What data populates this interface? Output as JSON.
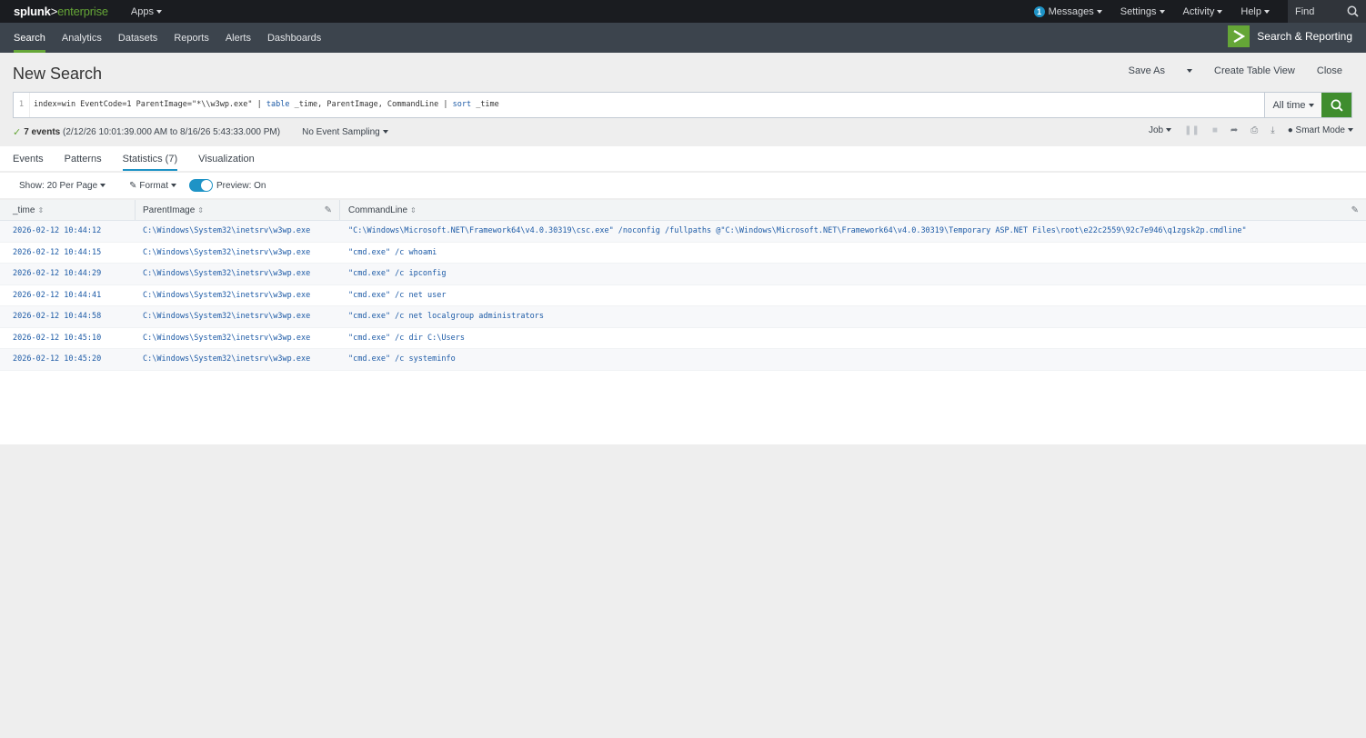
{
  "topbar": {
    "logo_brand": "splunk",
    "logo_gt": ">",
    "logo_product": "enterprise",
    "apps_label": "Apps",
    "messages_count": "1",
    "messages_label": "Messages",
    "settings_label": "Settings",
    "activity_label": "Activity",
    "help_label": "Help",
    "find_placeholder": "Find"
  },
  "appnav": {
    "items": [
      {
        "label": "Search",
        "active": true
      },
      {
        "label": "Analytics"
      },
      {
        "label": "Datasets"
      },
      {
        "label": "Reports"
      },
      {
        "label": "Alerts"
      },
      {
        "label": "Dashboards"
      }
    ],
    "app_title": "Search & Reporting",
    "app_color": "#65a637"
  },
  "header": {
    "title": "New Search",
    "save_as": "Save As",
    "create_table_view": "Create Table View",
    "close": "Close"
  },
  "search": {
    "line_number": "1",
    "query_part1": "index=win EventCode=1 ParentImage=\"*\\\\w3wp.exe\" | ",
    "query_kw1": "table",
    "query_part2": " _time, ParentImage, CommandLine | ",
    "query_kw2": "sort",
    "query_part3": " _time",
    "time_range": "All time"
  },
  "status": {
    "events_label": "7 events",
    "time_span": "(2/12/26 10:01:39.000 AM to 8/16/26 5:43:33.000 PM)",
    "sampling": "No Event Sampling",
    "job": "Job",
    "mode": "Smart Mode"
  },
  "tabs": [
    {
      "label": "Events"
    },
    {
      "label": "Patterns"
    },
    {
      "label": "Statistics (7)",
      "active": true
    },
    {
      "label": "Visualization"
    }
  ],
  "toolbar": {
    "per_page": "Show: 20 Per Page",
    "format": "Format",
    "preview": "Preview: On"
  },
  "table": {
    "columns": [
      "_time",
      "ParentImage",
      "CommandLine"
    ],
    "rows": [
      [
        "2026-02-12 10:44:12",
        "C:\\Windows\\System32\\inetsrv\\w3wp.exe",
        "\"C:\\Windows\\Microsoft.NET\\Framework64\\v4.0.30319\\csc.exe\" /noconfig /fullpaths @\"C:\\Windows\\Microsoft.NET\\Framework64\\v4.0.30319\\Temporary ASP.NET Files\\root\\e22c2559\\92c7e946\\q1zgsk2p.cmdline\""
      ],
      [
        "2026-02-12 10:44:15",
        "C:\\Windows\\System32\\inetsrv\\w3wp.exe",
        "\"cmd.exe\" /c whoami"
      ],
      [
        "2026-02-12 10:44:29",
        "C:\\Windows\\System32\\inetsrv\\w3wp.exe",
        "\"cmd.exe\" /c ipconfig"
      ],
      [
        "2026-02-12 10:44:41",
        "C:\\Windows\\System32\\inetsrv\\w3wp.exe",
        "\"cmd.exe\" /c net user"
      ],
      [
        "2026-02-12 10:44:58",
        "C:\\Windows\\System32\\inetsrv\\w3wp.exe",
        "\"cmd.exe\" /c net localgroup administrators"
      ],
      [
        "2026-02-12 10:45:10",
        "C:\\Windows\\System32\\inetsrv\\w3wp.exe",
        "\"cmd.exe\" /c dir C:\\Users"
      ],
      [
        "2026-02-12 10:45:20",
        "C:\\Windows\\System32\\inetsrv\\w3wp.exe",
        "\"cmd.exe\" /c systeminfo"
      ]
    ]
  }
}
